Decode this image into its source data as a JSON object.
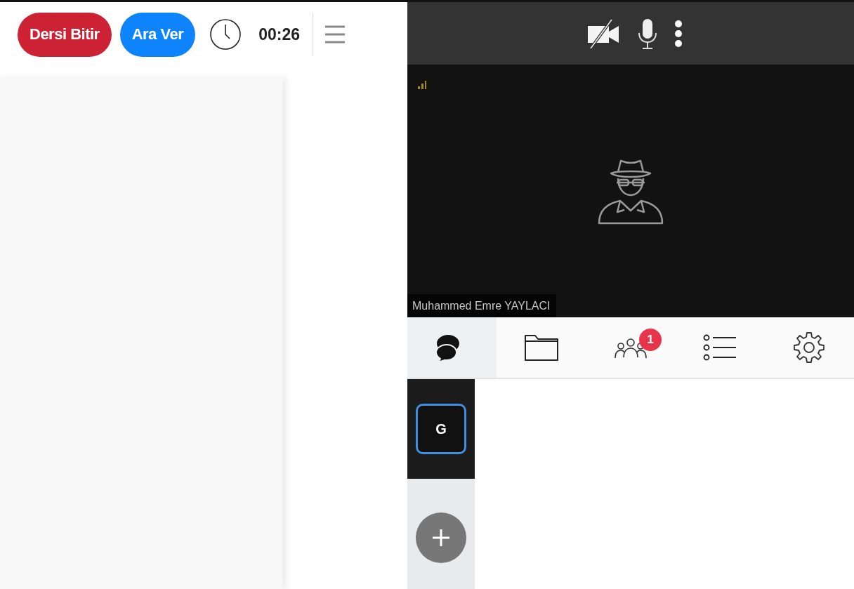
{
  "toolbar": {
    "buttons": [
      {
        "label": "Dersi Bitir",
        "kind": "danger"
      },
      {
        "label": "Ara Ver",
        "kind": "primary"
      }
    ],
    "timer": "00:26"
  },
  "media_controls": {
    "camera_on": false,
    "mic_on": true
  },
  "video": {
    "participant_name": "Muhammed Emre YAYLACI"
  },
  "tabs": [
    {
      "kind": "chat",
      "selected": true
    },
    {
      "kind": "files",
      "selected": false
    },
    {
      "kind": "participants",
      "selected": false,
      "badge": "1"
    },
    {
      "kind": "list",
      "selected": false
    },
    {
      "kind": "settings",
      "selected": false
    }
  ],
  "chat_rooms": [
    {
      "label": "G",
      "selected": true
    }
  ]
}
